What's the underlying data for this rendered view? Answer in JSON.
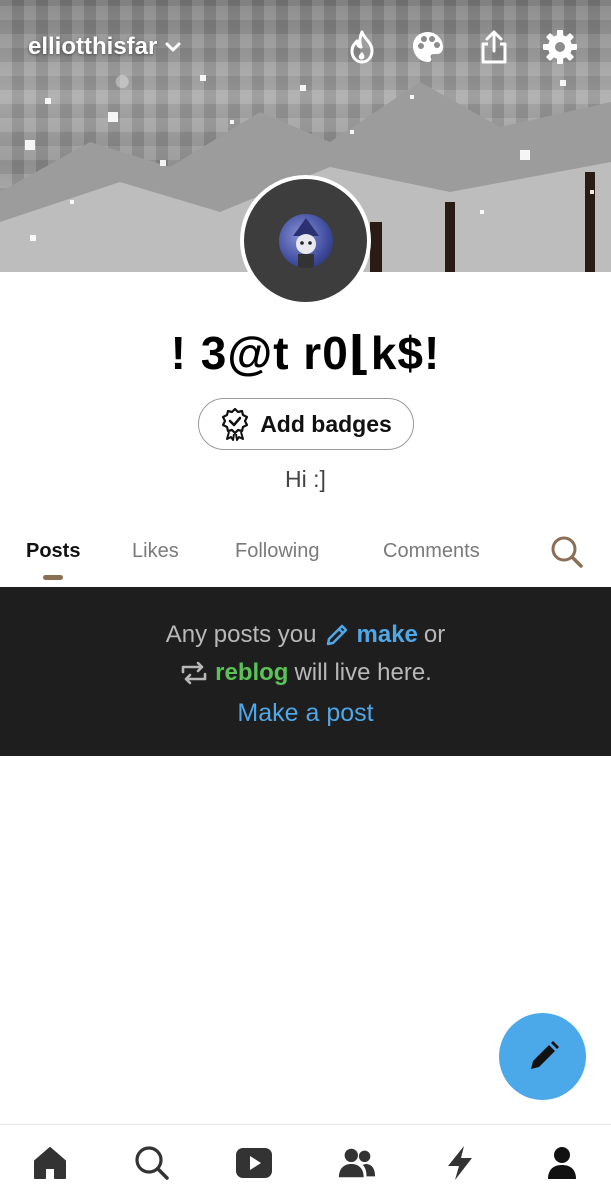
{
  "header": {
    "blog_name": "elliotthisfar",
    "icons": [
      "fire-icon",
      "palette-icon",
      "share-icon",
      "gear-icon"
    ]
  },
  "profile": {
    "title": "! 3@t r0⌊k$!",
    "badges_label": "Add badges",
    "bio": "Hi :]"
  },
  "tabs": {
    "posts": "Posts",
    "likes": "Likes",
    "following": "Following",
    "comments": "Comments",
    "active": "Posts"
  },
  "empty_state": {
    "line1_prefix": "Any posts you",
    "make": "make",
    "line1_suffix": "or",
    "reblog": "reblog",
    "line2_suffix": "will live here.",
    "cta": "Make a post"
  },
  "bottom_nav": [
    "home-icon",
    "search-icon",
    "video-icon",
    "community-icon",
    "activity-icon",
    "account-icon"
  ],
  "colors": {
    "accent_blue": "#4ba9e9",
    "reblog_green": "#5bc258",
    "tab_underline": "#8b6f55",
    "empty_bg": "#1e1e1e"
  }
}
